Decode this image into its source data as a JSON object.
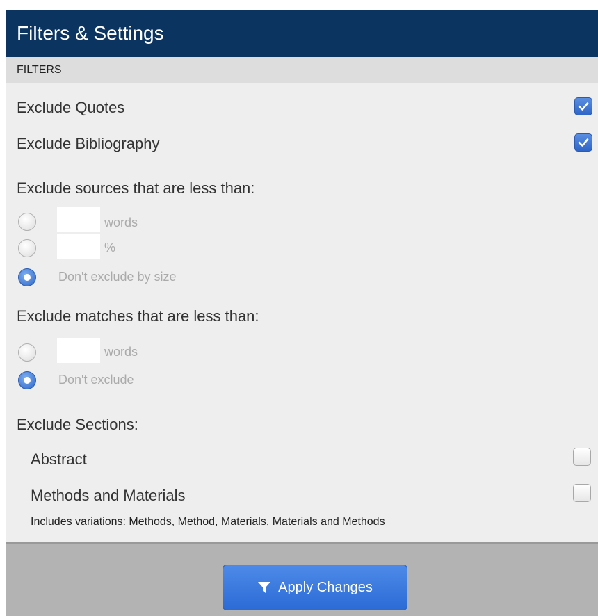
{
  "header": {
    "title": "Filters & Settings"
  },
  "filters": {
    "section_label": "FILTERS",
    "exclude_quotes": {
      "label": "Exclude Quotes",
      "checked": true
    },
    "exclude_bibliography": {
      "label": "Exclude Bibliography",
      "checked": true
    }
  },
  "sources": {
    "heading": "Exclude sources that are less than:",
    "options": [
      {
        "input_value": "",
        "unit": "words",
        "selected": false
      },
      {
        "input_value": "",
        "unit": "%",
        "selected": false
      },
      {
        "label": "Don't exclude by size",
        "selected": true
      }
    ]
  },
  "matches": {
    "heading": "Exclude matches that are less than:",
    "options": [
      {
        "input_value": "",
        "unit": "words",
        "selected": false
      },
      {
        "label": "Don't exclude",
        "selected": true
      }
    ]
  },
  "sections": {
    "heading": "Exclude Sections:",
    "abstract": {
      "label": "Abstract",
      "checked": false
    },
    "methods": {
      "label": "Methods and Materials",
      "checked": false
    },
    "note": "Includes variations: Methods, Method, Materials, Materials and Methods"
  },
  "footer": {
    "apply_label": "Apply Changes",
    "apply_icon": "filter-funnel-icon"
  },
  "colors": {
    "header_bg": "#0b3560",
    "accent": "#2f66c8",
    "footer_bg": "#b3b3b3"
  }
}
